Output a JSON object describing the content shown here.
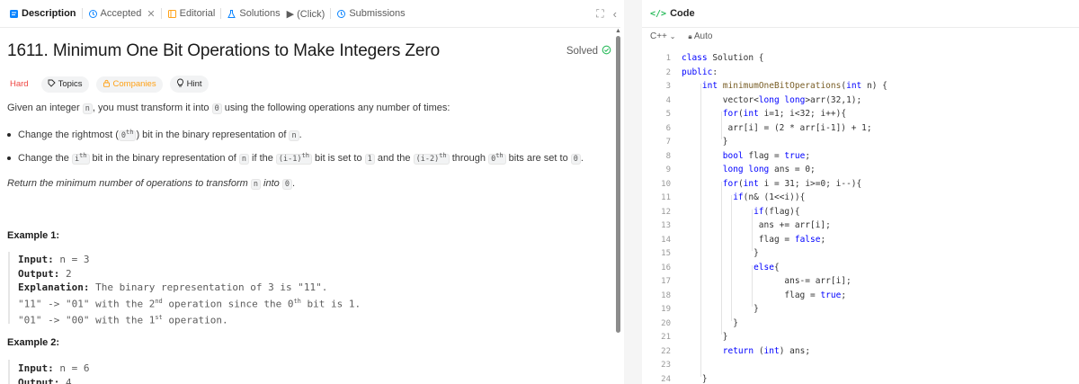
{
  "tabs": [
    {
      "id": "description",
      "label": "Description",
      "icon": "description-icon"
    },
    {
      "id": "accepted",
      "label": "Accepted",
      "icon": "history-icon"
    },
    {
      "id": "editorial",
      "label": "Editorial",
      "icon": "book-icon"
    },
    {
      "id": "solutions",
      "label": "Solutions",
      "icon": "flask-icon",
      "extra": "▶ (Click)"
    },
    {
      "id": "submissions",
      "label": "Submissions",
      "icon": "history-icon"
    }
  ],
  "problem": {
    "title": "1611. Minimum One Bit Operations to Make Integers Zero",
    "status": "Solved",
    "difficulty": "Hard",
    "tags": {
      "topics": "Topics",
      "companies": "Companies",
      "hint": "Hint"
    },
    "intro_a": "Given an integer ",
    "intro_n": "n",
    "intro_b": ", you must transform it into ",
    "intro_zero": "0",
    "intro_c": " using the following operations any number of times:",
    "op1_a": "Change the rightmost (",
    "op1_code": "0",
    "op1_sup": "th",
    "op1_b": ") bit in the binary representation of ",
    "op1_n": "n",
    "op1_c": ".",
    "op2_a": "Change the ",
    "op2_code1": "i",
    "op2_sup1": "th",
    "op2_b": " bit in the binary representation of ",
    "op2_n": "n",
    "op2_c": " if the ",
    "op2_code2": "(i-1)",
    "op2_sup2": "th",
    "op2_d": " bit is set to ",
    "op2_code3": "1",
    "op2_e": " and the ",
    "op2_code4": "(i-2)",
    "op2_sup3": "th",
    "op2_f": " through ",
    "op2_code5": "0",
    "op2_sup4": "th",
    "op2_g": " bits are set to ",
    "op2_code6": "0",
    "op2_h": ".",
    "ret_a": "Return the minimum number of operations to transform ",
    "ret_n": "n",
    "ret_b": " into ",
    "ret_zero": "0",
    "ret_c": "."
  },
  "examples": [
    {
      "heading": "Example 1:",
      "input_label": "Input:",
      "input": " n = 3",
      "output_label": "Output:",
      "output": " 2",
      "explanation_label": "Explanation:",
      "explanation": " The binary representation of 3 is \"11\".",
      "line2_a": "\"11\" -> \"01\" with the 2",
      "line2_sup": "nd",
      "line2_b": " operation since the 0",
      "line2_sup2": "th",
      "line2_c": " bit is 1.",
      "line3_a": "\"01\" -> \"00\" with the 1",
      "line3_sup": "st",
      "line3_b": " operation."
    },
    {
      "heading": "Example 2:",
      "input_label": "Input:",
      "input": " n = 6",
      "output_label": "Output:",
      "output": " 4"
    }
  ],
  "code_panel": {
    "title": "Code",
    "language": "C++",
    "autosave": "Auto",
    "lines": [
      "class Solution {",
      "public:",
      "    int minimumOneBitOperations(int n) {",
      "        vector<long long>arr(32,1);",
      "        for(int i=1; i<32; i++){",
      "         arr[i] = (2 * arr[i-1]) + 1;",
      "        }",
      "        bool flag = true;",
      "        long long ans = 0;",
      "        for(int i = 31; i>=0; i--){",
      "          if(n& (1<<i)){",
      "              if(flag){",
      "               ans += arr[i];",
      "               flag = false;",
      "              }",
      "              else{",
      "                    ans-= arr[i];",
      "                    flag = true;",
      "              }",
      "          }",
      "        }",
      "        return (int) ans;",
      "",
      "    }",
      "};"
    ]
  },
  "colors": {
    "hard": "#ef4743",
    "solved": "#2cbb5d",
    "accent": "#ffa116",
    "code_keyword": "#0000ff"
  }
}
